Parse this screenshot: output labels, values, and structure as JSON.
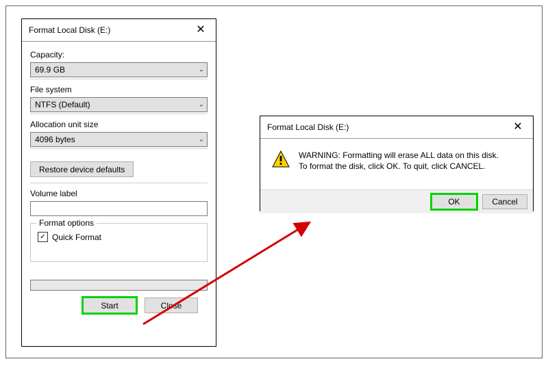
{
  "format_dialog": {
    "title": "Format Local Disk (E:)",
    "close_glyph": "✕",
    "capacity_label": "Capacity:",
    "capacity_value": "69.9 GB",
    "filesystem_label": "File system",
    "filesystem_value": "NTFS (Default)",
    "allocation_label": "Allocation unit size",
    "allocation_value": "4096 bytes",
    "restore_defaults_label": "Restore device defaults",
    "volume_label_label": "Volume label",
    "volume_label_value": "",
    "format_options_label": "Format options",
    "quick_format_label": "Quick Format",
    "quick_format_checked": "✓",
    "start_label": "Start",
    "close_label": "Close"
  },
  "warning_dialog": {
    "title": "Format Local Disk (E:)",
    "close_glyph": "✕",
    "warning_line1": "WARNING: Formatting will erase ALL data on this disk.",
    "warning_line2": "To format the disk, click OK. To quit, click CANCEL.",
    "ok_label": "OK",
    "cancel_label": "Cancel"
  },
  "icons": {
    "chevron_down": "⌄"
  }
}
